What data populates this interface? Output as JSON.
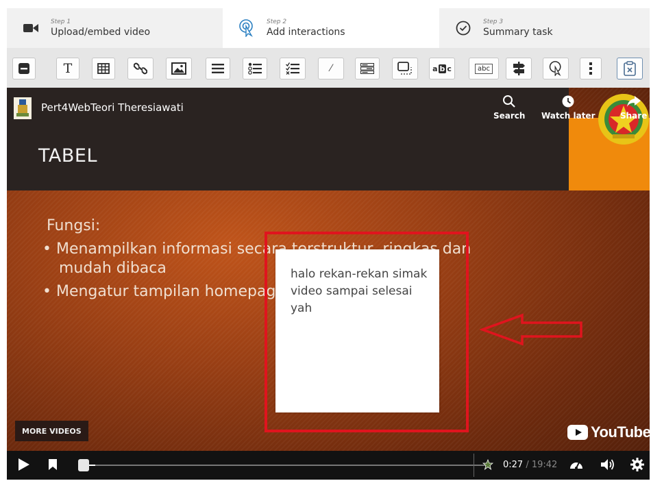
{
  "steps": [
    {
      "number": "Step 1",
      "label": "Upload/embed video",
      "icon": "video-camera-icon"
    },
    {
      "number": "Step 2",
      "label": "Add interactions",
      "icon": "pointer-click-icon"
    },
    {
      "number": "Step 3",
      "label": "Summary task",
      "icon": "check-circle-icon"
    }
  ],
  "toolbar": {
    "tools": [
      "label-tool-icon",
      "text-tool-icon",
      "table-tool-icon",
      "link-tool-icon",
      "image-tool-icon",
      "statements-tool-icon",
      "single-choice-tool-icon",
      "multiple-choice-tool-icon",
      "true-false-tool-icon",
      "fill-blanks-tool-icon",
      "drag-drop-tool-icon",
      "mark-words-tool-icon",
      "drag-text-tool-icon",
      "crossroads-tool-icon",
      "navigation-hotspot-icon",
      "more-tools-icon",
      "paste-icon"
    ],
    "text_tool_glyph": "T",
    "mark_words_glyph": "a",
    "mark_words_glyph_highlight": "b",
    "mark_words_glyph_end": "c",
    "drag_text_glyph": "abc",
    "percent_glyph": "⁄"
  },
  "video": {
    "channel_name": "Pert4WebTeori Theresiawati",
    "search_label": "Search",
    "watch_later_label": "Watch later",
    "share_label": "Share",
    "slide_title": "TABEL",
    "slide_lines": [
      "Fungsi:",
      "• Menampilkan informasi secara terstruktur, ringkas dan",
      "mudah dibaca",
      "• Mengatur tampilan homepage agar lebih menarik"
    ],
    "popup_text": "halo rekan-rekan simak video sampai selesai yah",
    "more_videos_label": "MORE VIDEOS",
    "youtube_label": "YouTube",
    "current_time": "0:27",
    "time_separator": " / ",
    "duration": "19:42",
    "progress_fraction": 0.023,
    "colors": {
      "highlight_box": "#e0141e",
      "slide_orange": "#f08a0c"
    }
  }
}
